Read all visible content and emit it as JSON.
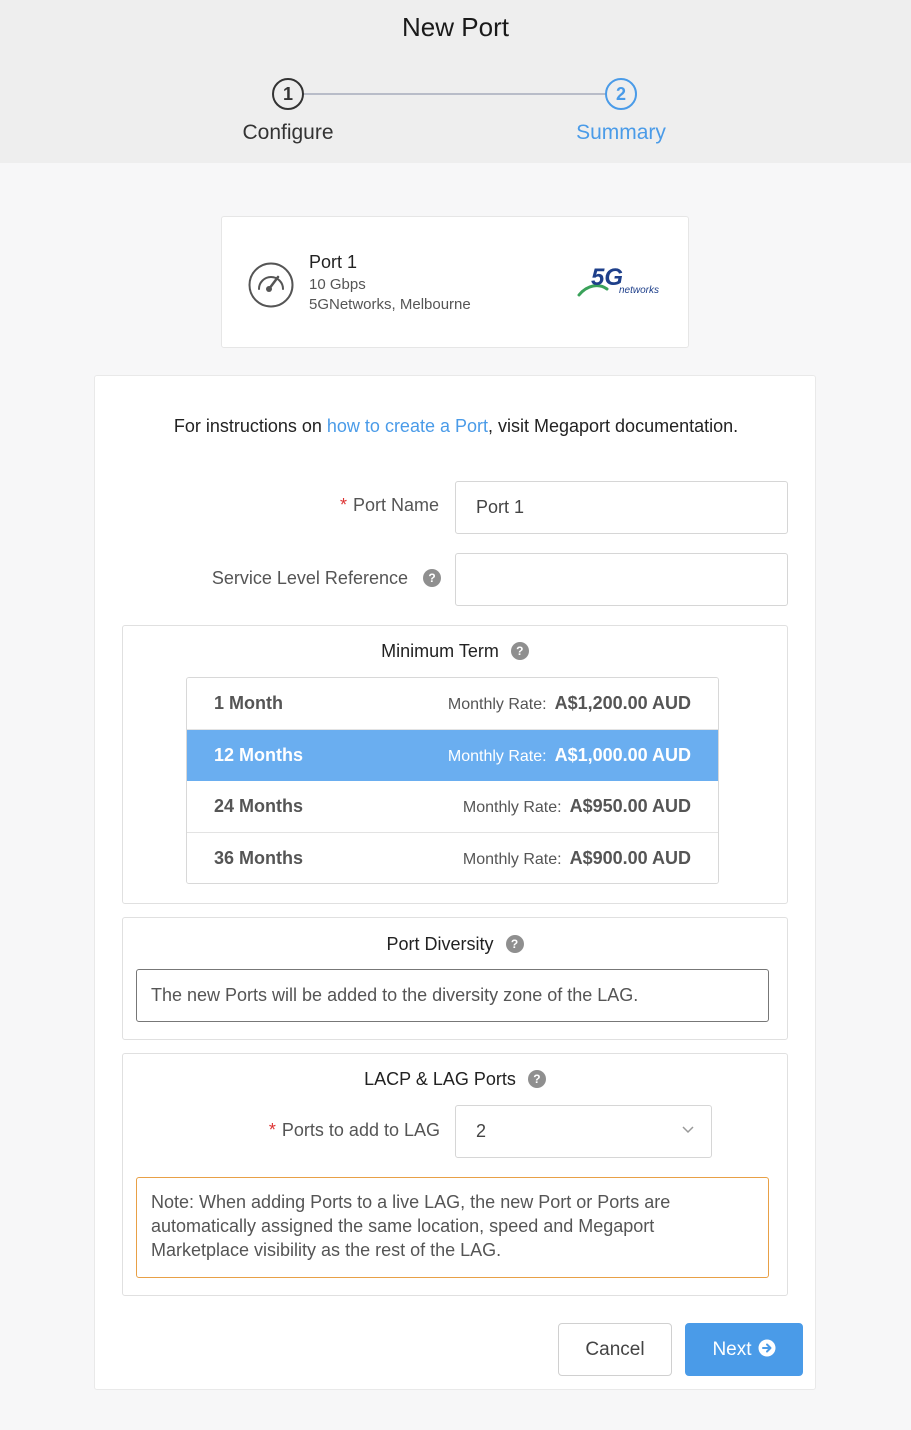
{
  "header": {
    "title": "New Port",
    "steps": [
      {
        "number": "1",
        "label": "Configure"
      },
      {
        "number": "2",
        "label": "Summary"
      }
    ]
  },
  "port_card": {
    "name": "Port 1",
    "speed": "10 Gbps",
    "location": "5GNetworks, Melbourne",
    "logo_text": "5G",
    "logo_subtext": "networks"
  },
  "instructions": {
    "prefix": "For instructions on ",
    "link": "how to create a Port",
    "suffix": ", visit Megaport documentation."
  },
  "form": {
    "port_name_label": "Port Name",
    "port_name_value": "Port 1",
    "service_level_label": "Service Level Reference",
    "service_level_value": ""
  },
  "minimum_term": {
    "title": "Minimum Term",
    "rate_label": "Monthly Rate:",
    "options": [
      {
        "name": "1 Month",
        "rate": "A$1,200.00 AUD",
        "selected": false
      },
      {
        "name": "12 Months",
        "rate": "A$1,000.00 AUD",
        "selected": true
      },
      {
        "name": "24 Months",
        "rate": "A$950.00 AUD",
        "selected": false
      },
      {
        "name": "36 Months",
        "rate": "A$900.00 AUD",
        "selected": false
      }
    ]
  },
  "port_diversity": {
    "title": "Port Diversity",
    "text": "The new Ports will be added to the diversity zone of the LAG."
  },
  "lacp": {
    "title": "LACP & LAG Ports",
    "ports_label": "Ports to add to LAG",
    "ports_value": "2",
    "note": "Note: When adding Ports to a live LAG, the new Port or Ports are automatically assigned the same location, speed and Megaport Marketplace visibility as the rest of the LAG."
  },
  "buttons": {
    "cancel": "Cancel",
    "next": "Next"
  },
  "help_glyph": "?",
  "required_glyph": "*",
  "colors": {
    "accent": "#4a9be8",
    "selected_row": "#6aaef0",
    "required": "#dd3333",
    "note_border": "#e8a046"
  }
}
